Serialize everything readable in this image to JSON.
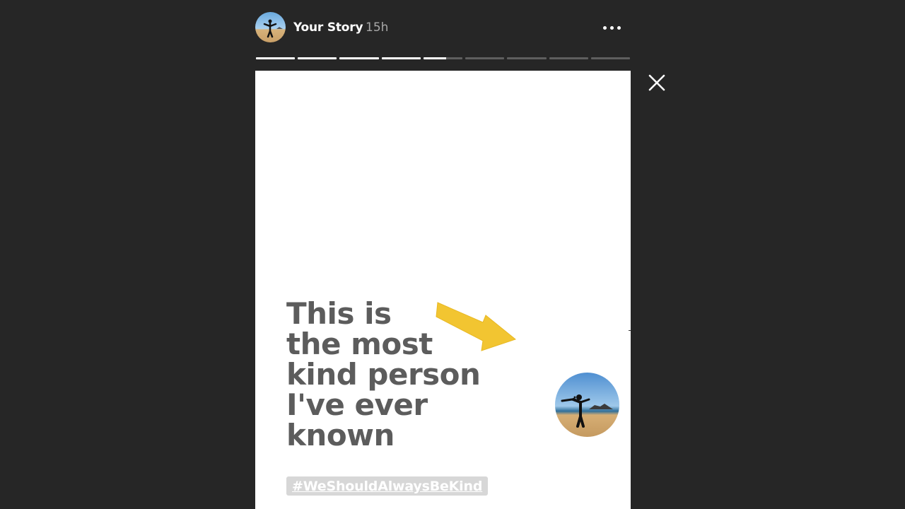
{
  "header": {
    "username": "Your Story",
    "timestamp": "15h"
  },
  "progress": {
    "segments_total": 9,
    "segments_completed": 4,
    "current_segment_fraction": 0.58
  },
  "story": {
    "text_lines": [
      "This is",
      "the most",
      "kind person",
      "I've ever",
      "known"
    ],
    "hashtag": "#WeShouldAlwaysBeKind"
  },
  "icons": {
    "more": "more-options-icon",
    "close": "close-icon",
    "arrow": "arrow-sticker"
  },
  "colors": {
    "background": "#262626",
    "card": "#ffffff",
    "text": "#5c5c5c",
    "arrow": "#f2c531",
    "hashtag_bg": "#d7d7d7"
  }
}
